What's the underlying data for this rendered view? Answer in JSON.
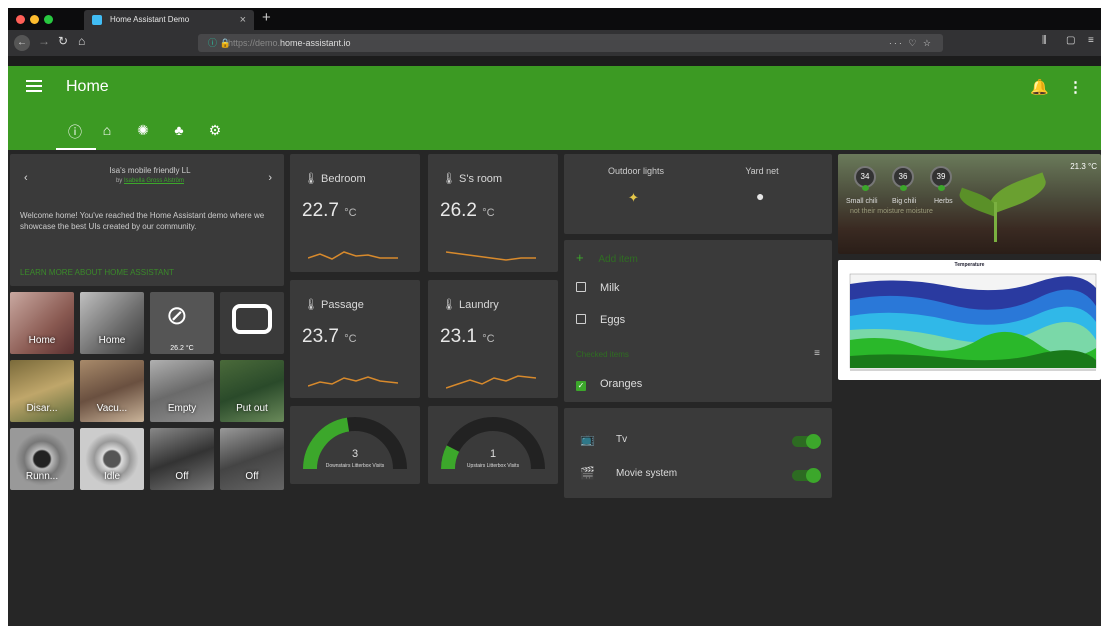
{
  "browser": {
    "tab_title": "Home Assistant Demo",
    "url_dim": "https://demo.",
    "url_main": "home-assistant.io",
    "url_actions": "··· ♡ ☆"
  },
  "header": {
    "title": "Home"
  },
  "intro": {
    "title": "Isa's mobile friendly LL",
    "byline_prefix": "by",
    "author": "Isabella Gross Alström",
    "welcome": "Welcome home! You've reached the Home Assistant demo where we showcase the best UIs created by our community.",
    "learn_more": "LEARN MORE ABOUT HOME ASSISTANT"
  },
  "pictures": [
    {
      "label": "Home"
    },
    {
      "label": "Home"
    },
    {
      "label": "",
      "temp": "26.2 °C"
    },
    {
      "label": ""
    },
    {
      "label": "Disar..."
    },
    {
      "label": "Vacu..."
    },
    {
      "label": "Empty"
    },
    {
      "label": "Put out"
    },
    {
      "label": "Runn..."
    },
    {
      "label": "Idle"
    },
    {
      "label": "Off"
    },
    {
      "label": "Off"
    }
  ],
  "sensors": [
    {
      "name": "Bedroom",
      "value": "22.7",
      "unit": "°C"
    },
    {
      "name": "S's room",
      "value": "26.2",
      "unit": "°C"
    },
    {
      "name": "Passage",
      "value": "23.7",
      "unit": "°C"
    },
    {
      "name": "Laundry",
      "value": "23.1",
      "unit": "°C"
    }
  ],
  "gauges": [
    {
      "value": "3",
      "fraction": 0.45,
      "label": "Downstairs Litterbox Visits"
    },
    {
      "value": "1",
      "fraction": 0.15,
      "label": "Upstairs Litterbox Visits"
    }
  ],
  "lights": [
    {
      "name": "Outdoor lights"
    },
    {
      "name": "Yard net"
    }
  ],
  "shopping": {
    "add_item": "Add item",
    "items": [
      "Milk",
      "Eggs"
    ],
    "checked_header": "Checked items",
    "checked": [
      "Oranges"
    ]
  },
  "switches": [
    {
      "name": "Tv",
      "on": true
    },
    {
      "name": "Movie system",
      "on": true
    }
  ],
  "plant": {
    "temperature": "21.3 °C",
    "badges": [
      {
        "value": "34",
        "name": "Small chili"
      },
      {
        "value": "36",
        "name": "Big chili"
      },
      {
        "value": "39",
        "name": "Herbs"
      }
    ],
    "caption": "not their moisture moisture"
  },
  "weather_chart": {
    "title": "Temperature"
  },
  "colors": {
    "accent": "#3c9a23",
    "card": "#3a3a3a",
    "background": "#262626"
  }
}
